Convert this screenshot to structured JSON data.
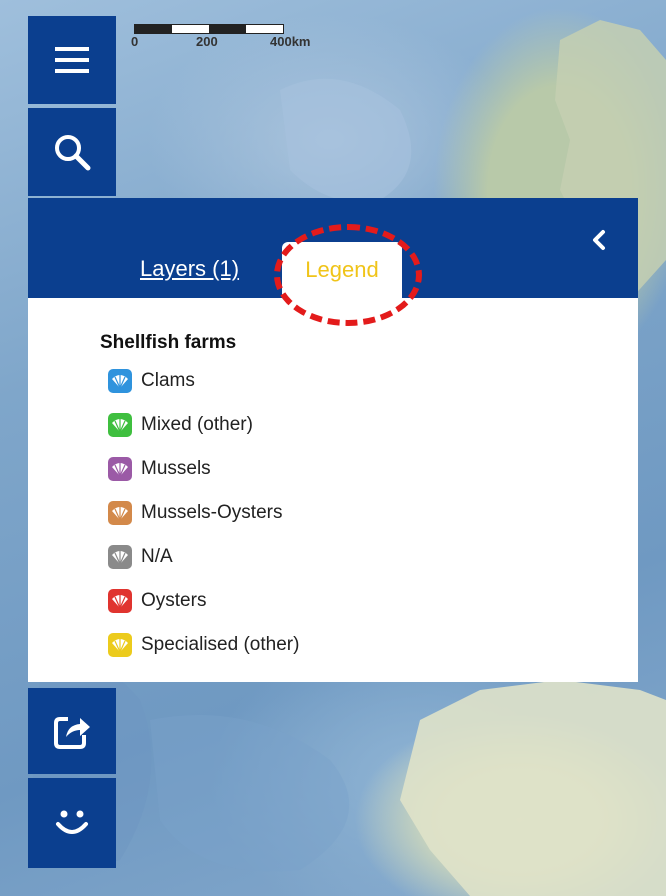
{
  "scalebar": {
    "labels": [
      "0",
      "200",
      "400km"
    ]
  },
  "toolbar": {
    "menu_icon": "hamburger-menu-icon",
    "search_icon": "search-icon",
    "share_icon": "share-icon",
    "feedback_icon": "smiley-icon"
  },
  "panel": {
    "tabs": {
      "layers": "Layers (1)",
      "legend": "Legend"
    },
    "active_tab": "legend",
    "collapse_icon": "chevron-left-icon",
    "legend": {
      "title": "Shellfish farms",
      "items": [
        {
          "label": "Clams",
          "color": "#2f93dd"
        },
        {
          "label": "Mixed (other)",
          "color": "#3fbf3f"
        },
        {
          "label": "Mussels",
          "color": "#9b5aa6"
        },
        {
          "label": "Mussels-Oysters",
          "color": "#d3894a"
        },
        {
          "label": "N/A",
          "color": "#8a8a8a"
        },
        {
          "label": "Oysters",
          "color": "#e0342f"
        },
        {
          "label": "Specialised (other)",
          "color": "#eccb1c"
        }
      ]
    }
  },
  "colors": {
    "brand_blue": "#0b3f8f",
    "active_tab_text": "#f0c419",
    "annotation_red": "#e31b1b"
  }
}
